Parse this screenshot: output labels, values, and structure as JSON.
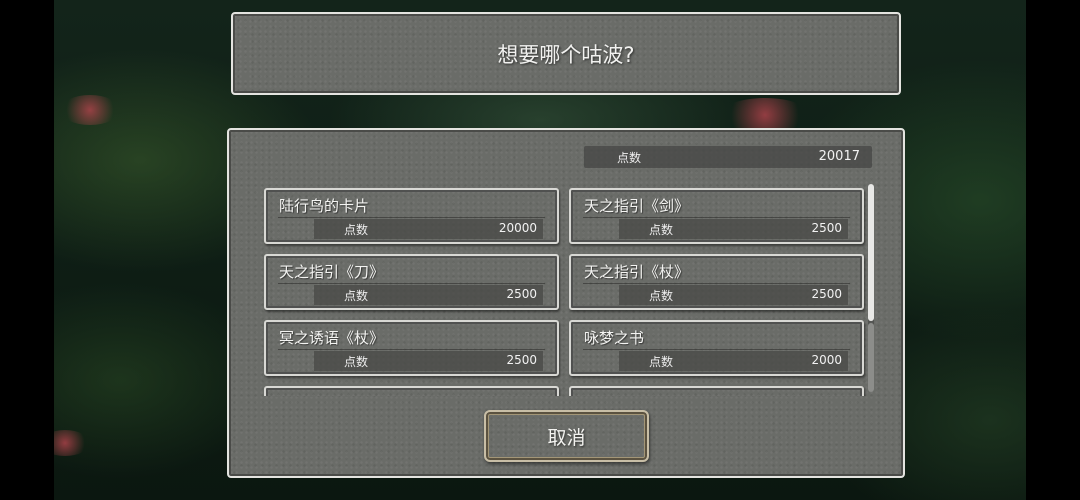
{
  "dialog": {
    "title": "想要哪个咕波?"
  },
  "points": {
    "label": "点数",
    "value": "20017"
  },
  "items": [
    {
      "name": "陆行鸟的卡片",
      "cost_label": "点数",
      "cost": "20000"
    },
    {
      "name": "天之指引《剑》",
      "cost_label": "点数",
      "cost": "2500"
    },
    {
      "name": "天之指引《刀》",
      "cost_label": "点数",
      "cost": "2500"
    },
    {
      "name": "天之指引《杖》",
      "cost_label": "点数",
      "cost": "2500"
    },
    {
      "name": "冥之诱语《杖》",
      "cost_label": "点数",
      "cost": "2500"
    },
    {
      "name": "咏梦之书",
      "cost_label": "点数",
      "cost": "2000"
    }
  ],
  "scroll": {
    "position_fraction": 0.66
  },
  "buttons": {
    "cancel_label": "取消"
  }
}
